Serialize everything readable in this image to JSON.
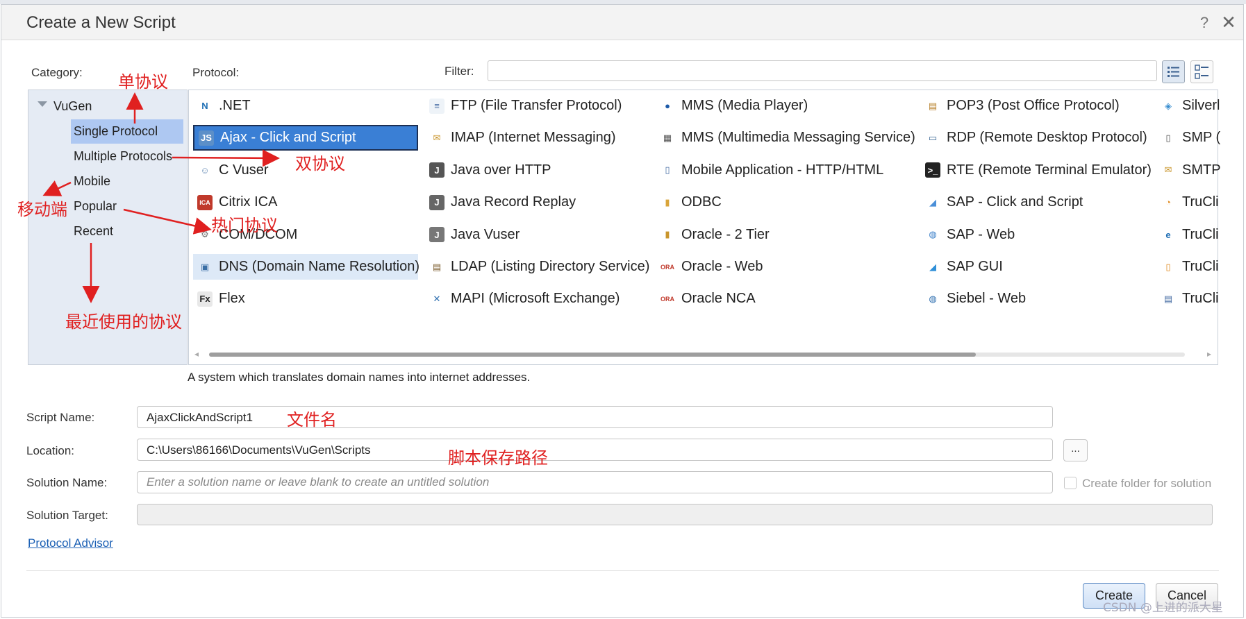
{
  "dialog": {
    "title": "Create a New Script",
    "help_glyph": "?",
    "close_glyph": "✕"
  },
  "labels": {
    "category": "Category:",
    "protocol": "Protocol:",
    "filter": "Filter:"
  },
  "filter": {
    "value": ""
  },
  "category_tree": {
    "root": "VuGen",
    "items": [
      {
        "label": "Single Protocol",
        "selected": true
      },
      {
        "label": "Multiple Protocols"
      },
      {
        "label": "Mobile"
      },
      {
        "label": "Popular"
      },
      {
        "label": "Recent"
      }
    ]
  },
  "protocols": [
    [
      {
        "label": ".NET",
        "icon": "dotnet-icon"
      },
      {
        "label": "Ajax - Click and Script",
        "icon": "ajax-icon",
        "selected": true
      },
      {
        "label": "C Vuser",
        "icon": "user-icon"
      },
      {
        "label": "Citrix ICA",
        "icon": "citrix-icon"
      },
      {
        "label": "COM/DCOM",
        "icon": "gear-icon"
      },
      {
        "label": "DNS (Domain Name Resolution)",
        "icon": "dns-icon",
        "highlighted": true
      },
      {
        "label": "Flex",
        "icon": "flex-icon"
      }
    ],
    [
      {
        "label": "FTP (File Transfer Protocol)",
        "icon": "ftp-icon"
      },
      {
        "label": "IMAP (Internet Messaging)",
        "icon": "envelope-icon"
      },
      {
        "label": "Java over HTTP",
        "icon": "java-http-icon"
      },
      {
        "label": "Java Record Replay",
        "icon": "java-record-icon"
      },
      {
        "label": "Java Vuser",
        "icon": "java-vuser-icon"
      },
      {
        "label": "LDAP (Listing Directory Service)",
        "icon": "ldap-icon"
      },
      {
        "label": "MAPI (Microsoft Exchange)",
        "icon": "mapi-icon"
      }
    ],
    [
      {
        "label": "MMS (Media Player)",
        "icon": "media-player-icon"
      },
      {
        "label": "MMS (Multimedia Messaging Service)",
        "icon": "mms-icon"
      },
      {
        "label": "Mobile Application - HTTP/HTML",
        "icon": "mobile-app-icon"
      },
      {
        "label": "ODBC",
        "icon": "database-icon"
      },
      {
        "label": "Oracle - 2 Tier",
        "icon": "oracle-2tier-icon"
      },
      {
        "label": "Oracle - Web",
        "icon": "oracle-web-icon"
      },
      {
        "label": "Oracle NCA",
        "icon": "oracle-nca-icon"
      }
    ],
    [
      {
        "label": "POP3 (Post Office Protocol)",
        "icon": "pop3-icon"
      },
      {
        "label": "RDP (Remote Desktop Protocol)",
        "icon": "rdp-icon"
      },
      {
        "label": "RTE (Remote Terminal Emulator)",
        "icon": "terminal-icon"
      },
      {
        "label": "SAP - Click and Script",
        "icon": "sap-click-icon"
      },
      {
        "label": "SAP - Web",
        "icon": "sap-web-icon"
      },
      {
        "label": "SAP GUI",
        "icon": "sap-gui-icon"
      },
      {
        "label": "Siebel - Web",
        "icon": "siebel-icon"
      }
    ],
    [
      {
        "label": "Silverl",
        "icon": "silverlight-icon"
      },
      {
        "label": "SMP (",
        "icon": "smp-icon"
      },
      {
        "label": "SMTP",
        "icon": "smtp-icon"
      },
      {
        "label": "TruCli",
        "icon": "truclient-icon"
      },
      {
        "label": "TruCli",
        "icon": "truclient-ie-icon"
      },
      {
        "label": "TruCli",
        "icon": "truclient-mobile-icon"
      },
      {
        "label": "TruCli",
        "icon": "truclient-native-icon"
      }
    ]
  ],
  "description": "A system which translates domain names into internet addresses.",
  "form": {
    "script_name_label": "Script Name:",
    "script_name_value": "AjaxClickAndScript1",
    "location_label": "Location:",
    "location_value": "C:\\Users\\86166\\Documents\\VuGen\\Scripts",
    "browse_label": "...",
    "solution_name_label": "Solution Name:",
    "solution_name_placeholder": "Enter a solution name or leave blank to create an untitled solution",
    "create_folder_label": "Create folder for solution",
    "solution_target_label": "Solution Target:",
    "solution_target_value": ""
  },
  "links": {
    "protocol_advisor": "Protocol Advisor"
  },
  "buttons": {
    "create": "Create",
    "cancel": "Cancel"
  },
  "annotations": {
    "single_protocol": "单协议",
    "multiple_protocols": "双协议",
    "mobile": "移动端",
    "popular": "热门协议",
    "recent": "最近使用的协议",
    "script_name": "文件名",
    "location": "脚本保存路径"
  },
  "watermark": "CSDN @上进的派大星",
  "colors": {
    "selection": "#3a7fd5",
    "category_selected": "#aec8f2",
    "annotation": "#e02020",
    "link": "#1a5fb4"
  }
}
